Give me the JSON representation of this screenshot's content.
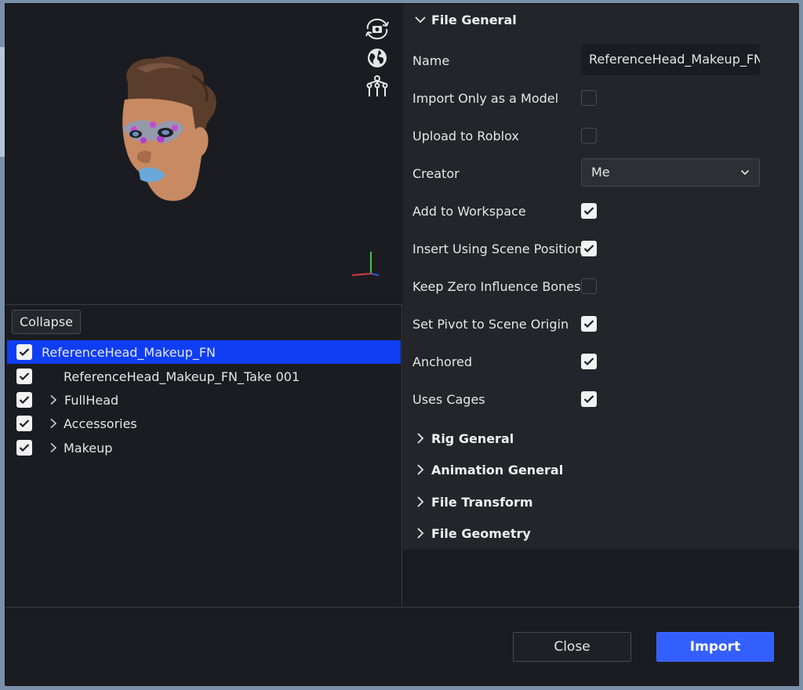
{
  "viewport": {
    "icons": [
      "camera-rotate-icon",
      "globe-icon",
      "rig-icon"
    ]
  },
  "tree": {
    "collapse_label": "Collapse",
    "rows": [
      {
        "label": "ReferenceHead_Makeup_FN",
        "checked": true,
        "expandable": false,
        "selected": true
      },
      {
        "label": "ReferenceHead_Makeup_FN_Take 001",
        "checked": true,
        "expandable": false,
        "selected": false
      },
      {
        "label": "FullHead",
        "checked": true,
        "expandable": true,
        "selected": false
      },
      {
        "label": "Accessories",
        "checked": true,
        "expandable": true,
        "selected": false
      },
      {
        "label": "Makeup",
        "checked": true,
        "expandable": true,
        "selected": false
      }
    ]
  },
  "file_general": {
    "title": "File General",
    "name_label": "Name",
    "name_value": "ReferenceHead_Makeup_FN",
    "creator_label": "Creator",
    "creator_value": "Me",
    "options": [
      {
        "label": "Import Only as a Model",
        "checked": false
      },
      {
        "label": "Upload to Roblox",
        "checked": false
      },
      {
        "label": "Add to Workspace",
        "checked": true
      },
      {
        "label": "Insert Using Scene Position",
        "checked": true
      },
      {
        "label": "Keep Zero Influence Bones",
        "checked": false
      },
      {
        "label": "Set Pivot to Scene Origin",
        "checked": true
      },
      {
        "label": "Anchored",
        "checked": true
      },
      {
        "label": "Uses Cages",
        "checked": true
      }
    ]
  },
  "sections": [
    "Rig General",
    "Animation General",
    "File Transform",
    "File Geometry"
  ],
  "footer": {
    "close_label": "Close",
    "import_label": "Import"
  },
  "colors": {
    "selection": "#0f3ef2",
    "primary_button": "#335fff",
    "panel_bg": "#1b1c21",
    "section_bg": "#24252a"
  }
}
